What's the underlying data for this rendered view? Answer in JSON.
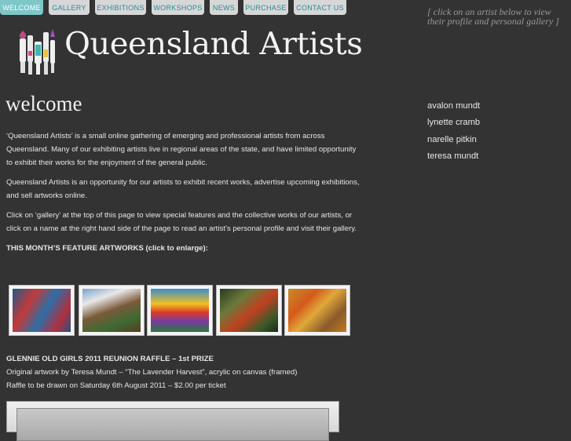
{
  "nav": {
    "items": [
      {
        "label": "WELCOME",
        "active": true
      },
      {
        "label": "GALLERY",
        "active": false
      },
      {
        "label": "EXHIBITIONS",
        "active": false
      },
      {
        "label": "WORKSHOPS",
        "active": false
      },
      {
        "label": "NEWS",
        "active": false
      },
      {
        "label": "PURCHASE",
        "active": false
      },
      {
        "label": "CONTACT US",
        "active": false
      }
    ]
  },
  "header": {
    "title": "Queensland Artists",
    "hint": "[ click on an artist below to view their profile and personal gallery ]"
  },
  "main": {
    "heading": "welcome",
    "paragraphs": [
      "‘Queensland Artists’ is a small online gathering of emerging and professional artists from across Queensland. Many of our exhibiting artists live in regional areas of the state, and have limited opportunity to exhibit their works for the enjoyment of the general public.",
      "Queensland Artists is an opportunity for our artists to exhibit recent works, advertise upcoming exhibitions, and sell artworks online.",
      "Click on ‘gallery’ at the top of this page to view special features and the collective works of our artists, or click on a name at the right hand side of the page to read an artist’s personal profile and visit their gallery."
    ],
    "feature_heading": "THIS MONTH’S FEATURE ARTWORKS (click to enlarge):",
    "raffle": {
      "title": "GLENNIE OLD GIRLS 2011 REUNION RAFFLE – 1st PRIZE",
      "line1": "Original artwork by Teresa Mundt – “The Lavender Harvest”, acrylic on canvas (framed)",
      "line2": "Raffle to be drawn on Saturday 6th August 2011 – $2.00 per ticket"
    }
  },
  "artists": [
    "avalon mundt",
    "lynette cramb",
    "narelle pitkin",
    "teresa mundt"
  ],
  "colors": {
    "background": "#333333",
    "nav_tab": "#d7d7d7",
    "nav_tab_text": "#2a8a96",
    "nav_active": "#7ec7c9"
  }
}
